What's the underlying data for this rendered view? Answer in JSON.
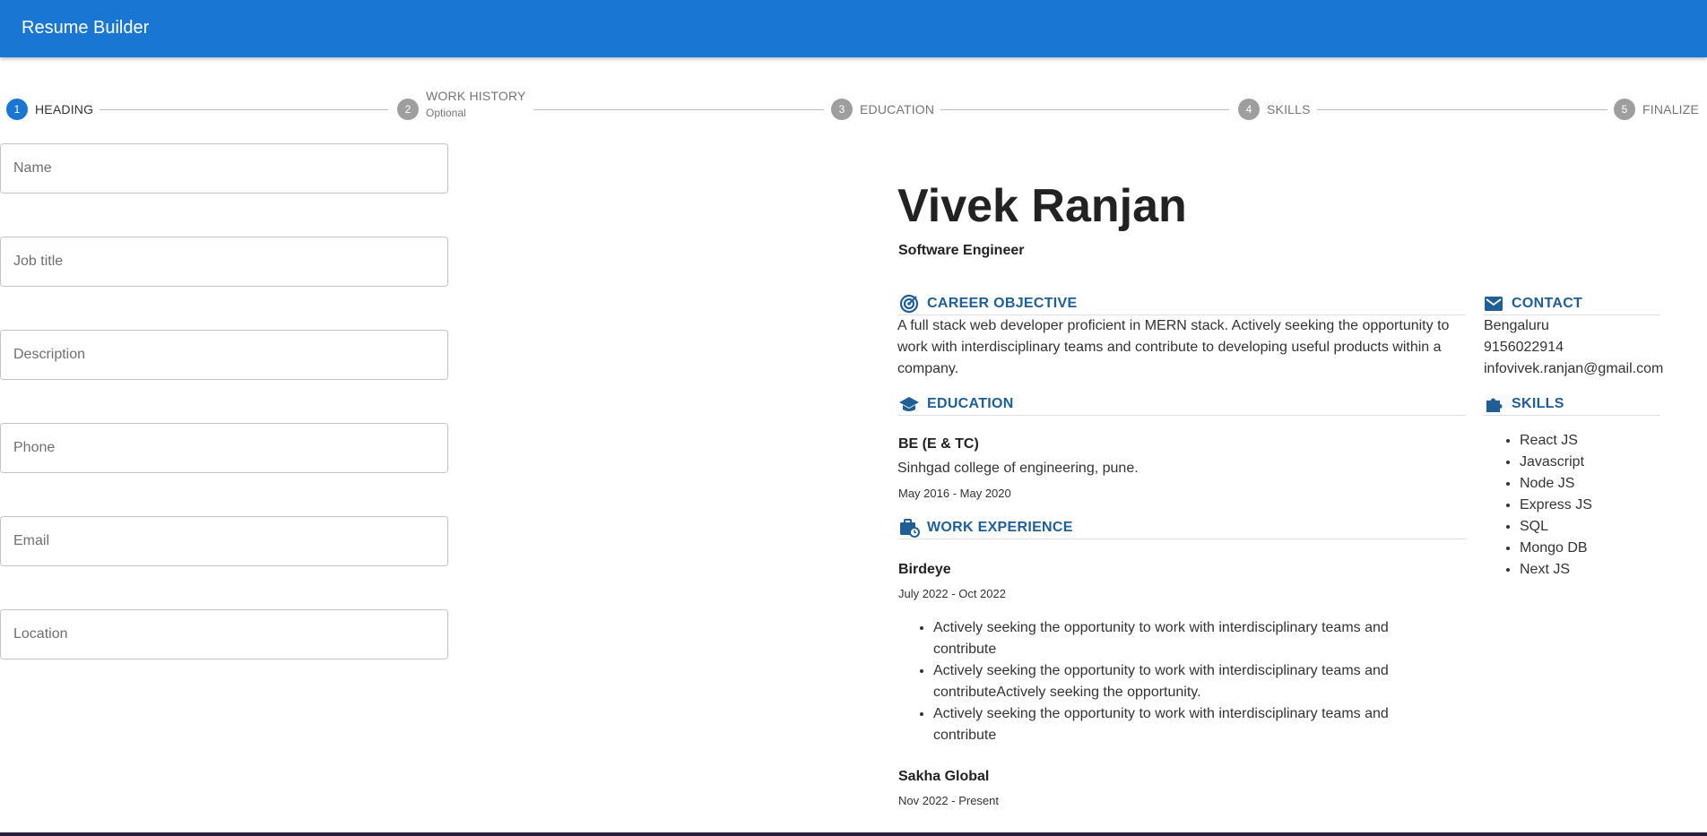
{
  "app": {
    "title": "Resume Builder"
  },
  "stepper": {
    "steps": [
      {
        "number": "1",
        "label": "HEADING",
        "sub": ""
      },
      {
        "number": "2",
        "label": "WORK HISTORY",
        "sub": "Optional"
      },
      {
        "number": "3",
        "label": "EDUCATION",
        "sub": ""
      },
      {
        "number": "4",
        "label": "SKILLS",
        "sub": ""
      },
      {
        "number": "5",
        "label": "FINALIZE",
        "sub": ""
      }
    ],
    "active_step": 1
  },
  "form": {
    "fields": [
      {
        "placeholder": "Name",
        "value": ""
      },
      {
        "placeholder": "Job title",
        "value": ""
      },
      {
        "placeholder": "Description",
        "value": ""
      },
      {
        "placeholder": "Phone",
        "value": ""
      },
      {
        "placeholder": "Email",
        "value": ""
      },
      {
        "placeholder": "Location",
        "value": ""
      }
    ]
  },
  "resume": {
    "name": "Vivek Ranjan",
    "job_title": "Software Engineer",
    "career_objective": {
      "title": "CAREER OBJECTIVE",
      "icon": "target-icon",
      "lines": [
        "A full stack web developer proficient in MERN stack. Actively seeking the opportunity to",
        "work with interdisciplinary teams and contribute to developing useful products within a",
        "company."
      ]
    },
    "education": {
      "title": "EDUCATION",
      "icon": "graduation-cap-icon",
      "degree": "BE (E & TC)",
      "school": "Sinhgad college of engineering, pune.",
      "dates": "May 2016 - May 2020"
    },
    "work_experience": {
      "title": "WORK EXPERIENCE",
      "icon": "briefcase-clock-icon",
      "jobs": [
        {
          "company": "Birdeye",
          "dates": "July 2022 - Oct 2022",
          "bullets": [
            [
              "Actively seeking the opportunity to work with interdisciplinary teams and",
              "contribute"
            ],
            [
              "Actively seeking the opportunity to work with interdisciplinary teams and",
              "contributeActively seeking the opportunity."
            ],
            [
              "Actively seeking the opportunity to work with interdisciplinary teams and",
              "contribute"
            ]
          ]
        },
        {
          "company": "Sakha Global",
          "dates": "Nov 2022 - Present"
        }
      ]
    },
    "contact": {
      "title": "CONTACT",
      "icon": "mail-icon",
      "location": "Bengaluru",
      "phone": "9156022914",
      "email": "infovivek.ranjan@gmail.com"
    },
    "skills": {
      "title": "SKILLS",
      "icon": "puzzle-icon",
      "items": [
        "React JS",
        "Javascript",
        "Node JS",
        "Express JS",
        "SQL",
        "Mongo DB",
        "Next JS"
      ]
    }
  },
  "colors": {
    "appbar": "#1976d2",
    "active_step": "#1976d2",
    "inactive_step": "#9e9e9e",
    "section_heading": "#1f5f96"
  }
}
